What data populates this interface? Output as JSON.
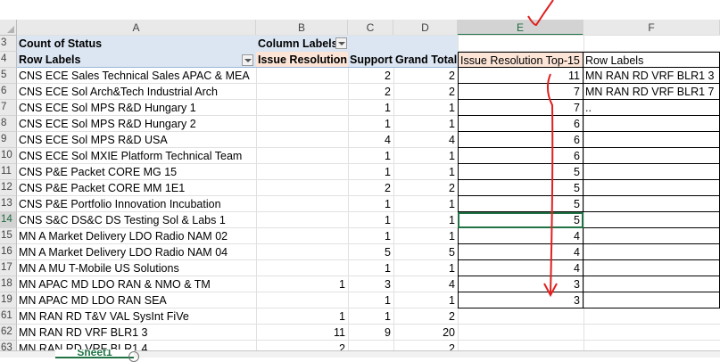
{
  "columns": [
    "A",
    "B",
    "C",
    "D",
    "E",
    "F"
  ],
  "selected_column": "E",
  "selected_row": "14",
  "pivot": {
    "count_label": "Count of Status",
    "column_labels": "Column Labels",
    "row_labels": "Row Labels",
    "col_issue": "Issue Resolution",
    "col_support": "Support",
    "col_total": "Grand Total"
  },
  "rows": [
    {
      "n": "5",
      "name": "CNS ECE Sales Technical Sales APAC & MEA",
      "b": "",
      "c": "2",
      "d": "2"
    },
    {
      "n": "6",
      "name": "CNS ECE Sol Arch&Tech Industrial Arch",
      "b": "",
      "c": "2",
      "d": "2"
    },
    {
      "n": "7",
      "name": "CNS ECE Sol MPS R&D Hungary 1",
      "b": "",
      "c": "1",
      "d": "1"
    },
    {
      "n": "8",
      "name": "CNS ECE Sol MPS R&D Hungary 2",
      "b": "",
      "c": "1",
      "d": "1"
    },
    {
      "n": "9",
      "name": "CNS ECE Sol MPS R&D USA",
      "b": "",
      "c": "4",
      "d": "4"
    },
    {
      "n": "10",
      "name": "CNS ECE Sol MXIE Platform Technical Team",
      "b": "",
      "c": "1",
      "d": "1"
    },
    {
      "n": "11",
      "name": "CNS P&E Packet CORE MG 15",
      "b": "",
      "c": "1",
      "d": "1"
    },
    {
      "n": "12",
      "name": "CNS P&E Packet CORE MM 1E1",
      "b": "",
      "c": "2",
      "d": "2"
    },
    {
      "n": "13",
      "name": "CNS P&E Portfolio Innovation Incubation",
      "b": "",
      "c": "1",
      "d": "1"
    },
    {
      "n": "14",
      "name": "CNS S&C DS&C DS Testing Sol & Labs 1",
      "b": "",
      "c": "1",
      "d": "1"
    },
    {
      "n": "15",
      "name": "MN A Market Delivery LDO Radio NAM 02",
      "b": "",
      "c": "1",
      "d": "1"
    },
    {
      "n": "16",
      "name": "MN A Market Delivery LDO Radio NAM 04",
      "b": "",
      "c": "5",
      "d": "5"
    },
    {
      "n": "17",
      "name": "MN A MU T-Mobile US Solutions",
      "b": "",
      "c": "1",
      "d": "1"
    },
    {
      "n": "18",
      "name": "MN APAC MD LDO RAN & NMO & TM",
      "b": "1",
      "c": "3",
      "d": "4"
    },
    {
      "n": "19",
      "name": "MN APAC MD LDO RAN SEA",
      "b": "",
      "c": "1",
      "d": "1"
    },
    {
      "n": "61",
      "name": "MN RAN RD T&V VAL SysInt FiVe",
      "b": "1",
      "c": "1",
      "d": "2"
    },
    {
      "n": "62",
      "name": "MN RAN RD VRF BLR1 3",
      "b": "11",
      "c": "9",
      "d": "20"
    },
    {
      "n": "63",
      "name": "MN RAN RD VRF BLR1 4",
      "b": "2",
      "c": "",
      "d": "2"
    }
  ],
  "e_header": "Issue Resolution Top-15",
  "e_values": [
    "11",
    "7",
    "7",
    "6",
    "6",
    "6",
    "5",
    "5",
    "5",
    "5",
    "4",
    "4",
    "4",
    "3",
    "3"
  ],
  "f_header": "Row Labels",
  "f_values": [
    "MN RAN RD VRF BLR1 3",
    "MN RAN RD VRF BLR1 7",
    ".."
  ],
  "sheet_tab": "Sheet1",
  "colors": {
    "accent": "#217346",
    "annotation": "#e02020",
    "pivot_header": "#dce6f2",
    "e_header": "#fce4d6"
  }
}
